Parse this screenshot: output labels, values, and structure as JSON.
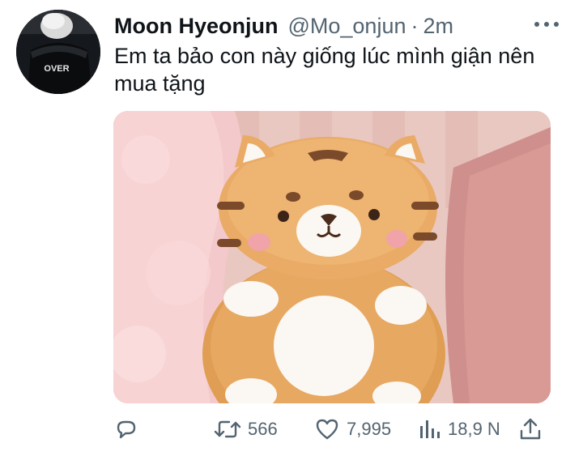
{
  "tweet": {
    "author_name": "Moon Hyeonjun",
    "author_handle": "@Mo_onjun",
    "separator": "·",
    "time": "2m",
    "text": "Em ta bảo con này giống lúc mình giận nên mua tặng",
    "avatar_jersey_text": "OVER",
    "media_alt": "plush-tiger-photo"
  },
  "actions": {
    "reply_icon": "reply-icon",
    "retweet_icon": "retweet-icon",
    "retweet_count": "566",
    "like_icon": "heart-icon",
    "like_count": "7,995",
    "views_icon": "analytics-icon",
    "views_count": "18,9 N",
    "share_icon": "share-icon"
  },
  "colors": {
    "text": "#0f1419",
    "secondary": "#536471",
    "background": "#ffffff"
  }
}
